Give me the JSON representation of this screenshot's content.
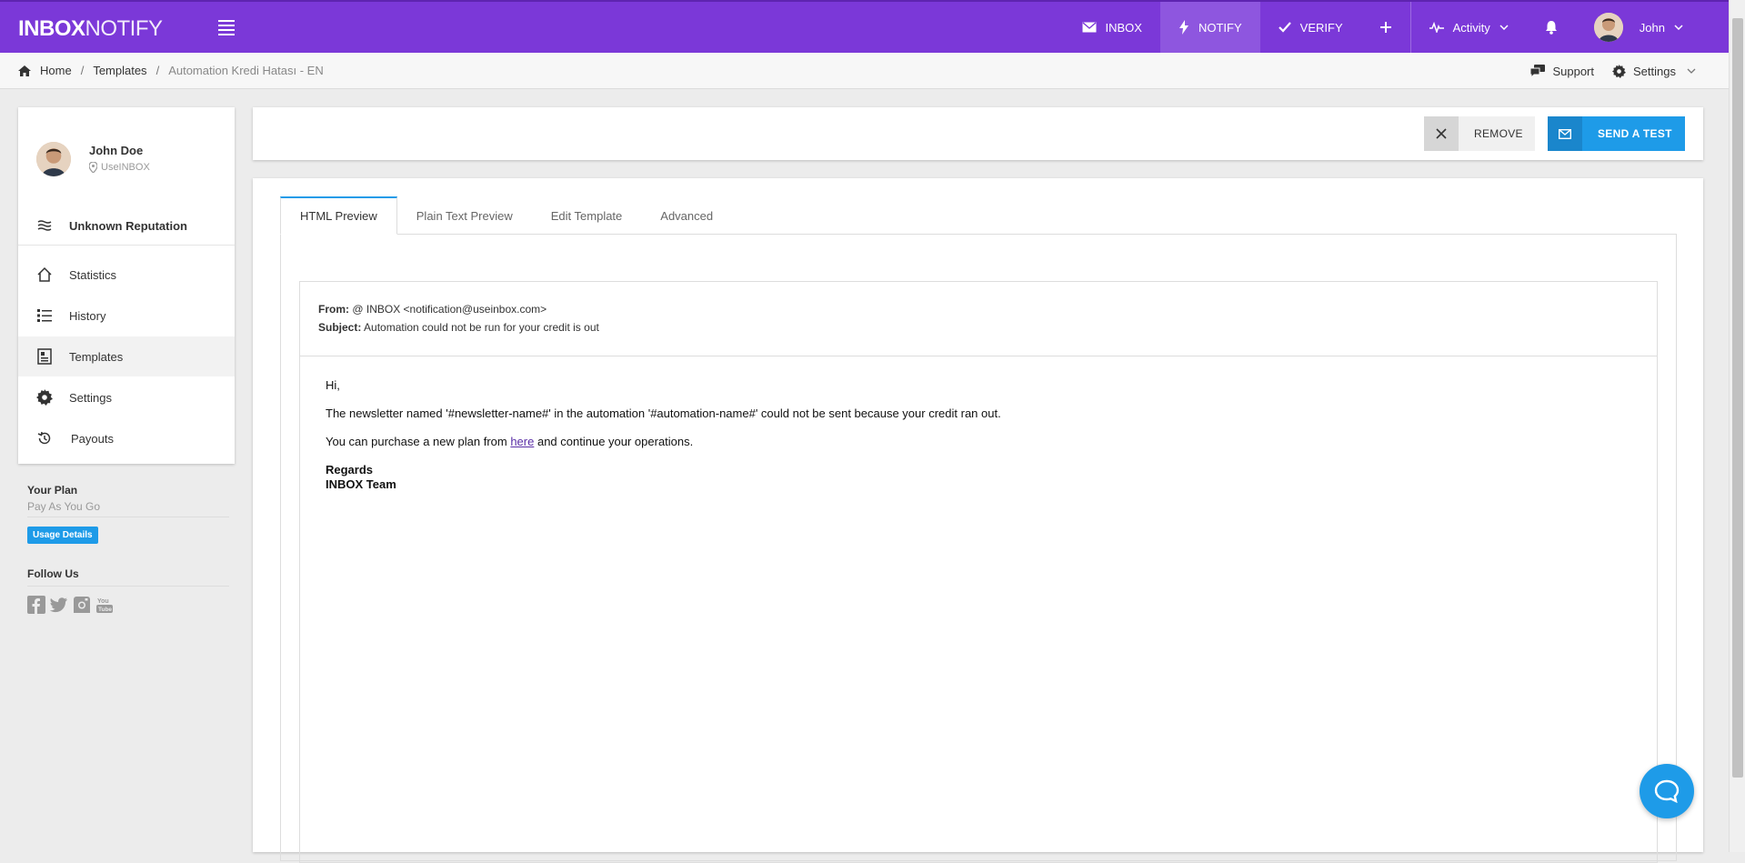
{
  "topbar": {
    "logo_bold": "INBOX",
    "logo_light": "NOTIFY",
    "nav": {
      "inbox": "INBOX",
      "notify": "NOTIFY",
      "verify": "VERIFY",
      "activity": "Activity",
      "user": "John"
    }
  },
  "breadcrumb": {
    "home": "Home",
    "templates": "Templates",
    "current": "Automation Kredi Hatası - EN",
    "support": "Support",
    "settings": "Settings"
  },
  "sidebar": {
    "user_name": "John Doe",
    "user_org": "UseINBOX",
    "reputation": "Unknown Reputation",
    "items": [
      {
        "label": "Statistics",
        "icon": "home-icon"
      },
      {
        "label": "History",
        "icon": "list-icon"
      },
      {
        "label": "Templates",
        "icon": "template-icon"
      },
      {
        "label": "Settings",
        "icon": "gear-icon"
      },
      {
        "label": "Payouts",
        "icon": "history-icon"
      }
    ],
    "plan_heading": "Your Plan",
    "plan_name": "Pay As You Go",
    "usage_button": "Usage Details",
    "follow_heading": "Follow Us"
  },
  "actions": {
    "remove": "REMOVE",
    "send_test": "SEND A TEST"
  },
  "tabs": [
    "HTML Preview",
    "Plain Text Preview",
    "Edit Template",
    "Advanced"
  ],
  "email": {
    "from_label": "From:",
    "from_value": "@ INBOX <notification@useinbox.com>",
    "subject_label": "Subject:",
    "subject_value": "Automation could not be run for your credit is out",
    "greeting": "Hi,",
    "line1": "The newsletter named '#newsletter-name#' in the automation '#automation-name#' could not be sent because your credit ran out.",
    "line2_pre": "You can purchase a new plan from ",
    "line2_link": "here",
    "line2_post": " and continue your operations.",
    "sig1": "Regards",
    "sig2": "INBOX Team"
  },
  "colors": {
    "topbar": "#7b38d8",
    "accent": "#1e9be8"
  }
}
